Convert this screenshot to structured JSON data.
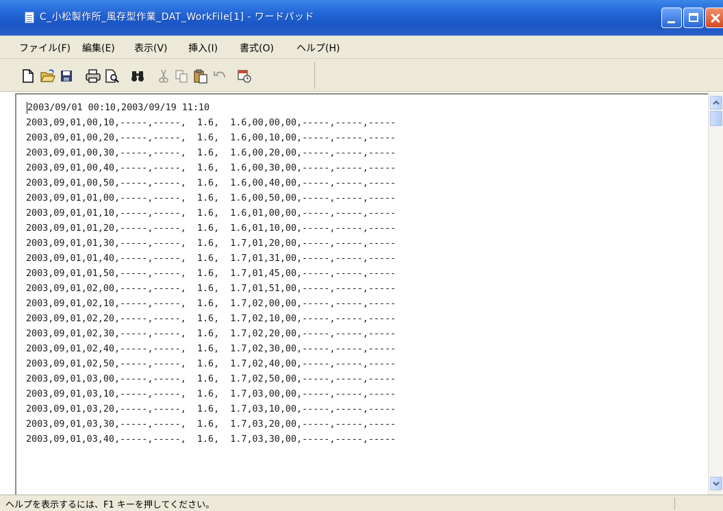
{
  "window": {
    "title": "C_小松製作所_風存型作業_DAT_WorkFile[1] - ワードパッド",
    "app_icon": "wordpad-document-icon",
    "controls": [
      "minimize",
      "maximize",
      "close"
    ]
  },
  "menu": {
    "items": [
      {
        "label": "ファイル(F)"
      },
      {
        "label": "編集(E)"
      },
      {
        "label": "表示(V)"
      },
      {
        "label": "挿入(I)"
      },
      {
        "label": "書式(O)"
      },
      {
        "label": "ヘルプ(H)"
      }
    ]
  },
  "toolbar": {
    "buttons": [
      "new-document",
      "open",
      "save",
      "print",
      "print-preview",
      "find",
      "cut",
      "copy",
      "paste",
      "undo",
      "date-time"
    ]
  },
  "document": {
    "lines": [
      "2003/09/01 00:10,2003/09/19 11:10",
      "2003,09,01,00,10,-----,-----,  1.6,  1.6,00,00,00,-----,-----,-----",
      "2003,09,01,00,20,-----,-----,  1.6,  1.6,00,10,00,-----,-----,-----",
      "2003,09,01,00,30,-----,-----,  1.6,  1.6,00,20,00,-----,-----,-----",
      "2003,09,01,00,40,-----,-----,  1.6,  1.6,00,30,00,-----,-----,-----",
      "2003,09,01,00,50,-----,-----,  1.6,  1.6,00,40,00,-----,-----,-----",
      "2003,09,01,01,00,-----,-----,  1.6,  1.6,00,50,00,-----,-----,-----",
      "2003,09,01,01,10,-----,-----,  1.6,  1.6,01,00,00,-----,-----,-----",
      "2003,09,01,01,20,-----,-----,  1.6,  1.6,01,10,00,-----,-----,-----",
      "2003,09,01,01,30,-----,-----,  1.6,  1.7,01,20,00,-----,-----,-----",
      "2003,09,01,01,40,-----,-----,  1.6,  1.7,01,31,00,-----,-----,-----",
      "2003,09,01,01,50,-----,-----,  1.6,  1.7,01,45,00,-----,-----,-----",
      "2003,09,01,02,00,-----,-----,  1.6,  1.7,01,51,00,-----,-----,-----",
      "2003,09,01,02,10,-----,-----,  1.6,  1.7,02,00,00,-----,-----,-----",
      "2003,09,01,02,20,-----,-----,  1.6,  1.7,02,10,00,-----,-----,-----",
      "2003,09,01,02,30,-----,-----,  1.6,  1.7,02,20,00,-----,-----,-----",
      "2003,09,01,02,40,-----,-----,  1.6,  1.7,02,30,00,-----,-----,-----",
      "2003,09,01,02,50,-----,-----,  1.6,  1.7,02,40,00,-----,-----,-----",
      "2003,09,01,03,00,-----,-----,  1.6,  1.7,02,50,00,-----,-----,-----",
      "2003,09,01,03,10,-----,-----,  1.6,  1.7,03,00,00,-----,-----,-----",
      "2003,09,01,03,20,-----,-----,  1.6,  1.7,03,10,00,-----,-----,-----",
      "2003,09,01,03,30,-----,-----,  1.6,  1.7,03,20,00,-----,-----,-----",
      "2003,09,01,03,40,-----,-----,  1.6,  1.7,03,30,00,-----,-----,-----"
    ]
  },
  "status": {
    "text": "ヘルプを表示するには、F1 キーを押してください。"
  },
  "colors": {
    "titlebar": "#2468d8",
    "chrome": "#ece9d8",
    "close_button": "#d2491f"
  }
}
